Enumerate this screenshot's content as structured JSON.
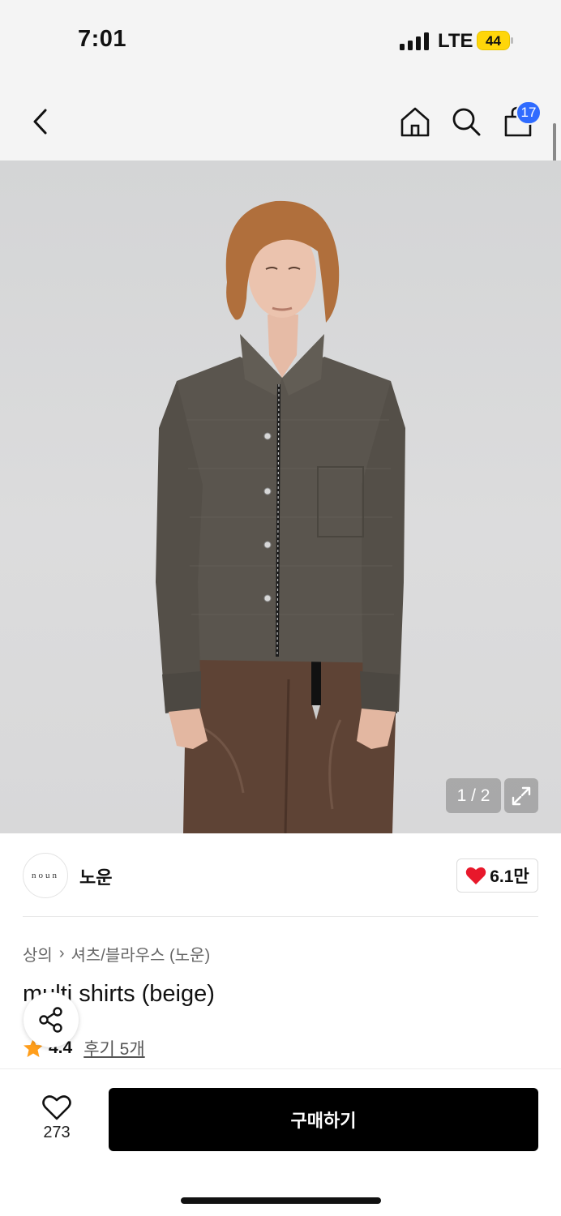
{
  "status_bar": {
    "time": "7:01",
    "network": "LTE",
    "battery": "44"
  },
  "nav": {
    "back_icon": "chevron-left-icon",
    "home_icon": "home-icon",
    "search_icon": "search-icon",
    "cart_icon": "shopping-bag-icon",
    "cart_count": "17"
  },
  "gallery": {
    "counter": "1 / 2",
    "thumbnail_arrow": "›",
    "expand_icon": "expand-icon",
    "background": "#d6d7d8"
  },
  "brand": {
    "logo_text": "noun",
    "name": "노운",
    "likes": "6.1만",
    "heart_color": "#e8182b"
  },
  "breadcrumb": {
    "category": "상의",
    "separator": "›",
    "subcategory": "셔츠/블라우스 (노운)"
  },
  "product": {
    "title": "multi shirts (beige)"
  },
  "rating": {
    "score": "4.4",
    "reviews": "후기 5개",
    "star_color": "#ff9e1b"
  },
  "share": {
    "icon": "share-icon"
  },
  "bottom": {
    "wish_count": "273",
    "buy_label": "구매하기"
  },
  "colors": {
    "accent_badge": "#2f6bff",
    "buy_button": "#000000"
  }
}
